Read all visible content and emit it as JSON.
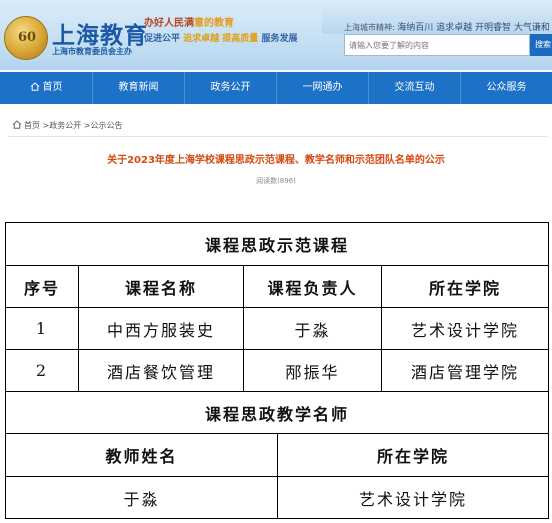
{
  "header": {
    "emblem_text": "60",
    "site_title": "上海教育",
    "site_subtitle": "上海市教育委员会主办",
    "slogan_line1_a": "办好人民满",
    "slogan_line1_b": "意的教育",
    "slogan_line2_a": "促进公平",
    "slogan_line2_b": "追求卓越 提高质量",
    "slogan_line2_c": "服务发展",
    "motto_label": "上海城市精神:",
    "motto_text": "海纳百川 追求卓越 开明睿智 大气谦和",
    "search_placeholder": "请输入您要了解的内容",
    "search_button": "搜索"
  },
  "nav": {
    "items": [
      {
        "label": "首页"
      },
      {
        "label": "教育新闻"
      },
      {
        "label": "政务公开"
      },
      {
        "label": "一网通办"
      },
      {
        "label": "交流互动"
      },
      {
        "label": "公众服务"
      }
    ]
  },
  "breadcrumb": {
    "items": [
      "首页",
      "政务公开",
      "公示公告"
    ],
    "separator": ">"
  },
  "article": {
    "title": "关于2023年度上海学校课程思政示范课程、教学名师和示范团队名单的公示",
    "views": "阅读数(896)"
  },
  "table": {
    "section1_title": "课程思政示范课程",
    "headers1": [
      "序号",
      "课程名称",
      "课程负责人",
      "所在学院"
    ],
    "rows1": [
      [
        "1",
        "中西方服装史",
        "于淼",
        "艺术设计学院"
      ],
      [
        "2",
        "酒店餐饮管理",
        "邴振华",
        "酒店管理学院"
      ]
    ],
    "section2_title": "课程思政教学名师",
    "headers2": [
      "教师姓名",
      "所在学院"
    ],
    "rows2": [
      [
        "于淼",
        "艺术设计学院"
      ]
    ]
  },
  "colors": {
    "nav_bg": "#1d72c8",
    "title_orange": "#d44a12",
    "brand_blue": "#1c5aa6"
  }
}
